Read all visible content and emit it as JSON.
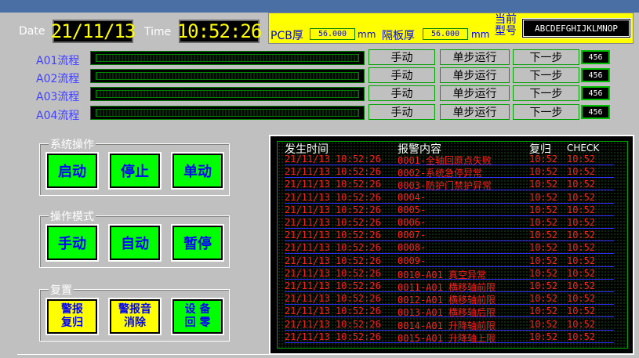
{
  "header": {
    "date_label": "Date",
    "date_value": "21/11/13",
    "time_label": "Time",
    "time_value": "10:52:26"
  },
  "pcb_panel": {
    "pcb_label": "PCB厚",
    "pcb_value": "56.000",
    "pcb_unit": "mm",
    "spacer_label": "隔板厚",
    "spacer_value": "56.000",
    "spacer_unit": "mm",
    "type_label_top": "当前",
    "type_label_bottom": "型号",
    "type_value": "ABCDEFGHIJKLMNOP"
  },
  "processes": [
    {
      "label": "A01流程",
      "manual": "手动",
      "step_run": "单步运行",
      "next": "下一步",
      "count": "456"
    },
    {
      "label": "A02流程",
      "manual": "手动",
      "step_run": "单步运行",
      "next": "下一步",
      "count": "456"
    },
    {
      "label": "A03流程",
      "manual": "手动",
      "step_run": "单步运行",
      "next": "下一步",
      "count": "456"
    },
    {
      "label": "A04流程",
      "manual": "手动",
      "step_run": "单步运行",
      "next": "下一步",
      "count": "456"
    }
  ],
  "system_ops": {
    "title": "系统操作",
    "start": "启动",
    "stop": "停止",
    "single": "单动"
  },
  "mode": {
    "title": "操作模式",
    "manual": "手动",
    "auto": "自动",
    "pause": "暂停"
  },
  "reset": {
    "title": "复置",
    "alarm_reset_1": "警报",
    "alarm_reset_2": "复归",
    "alarm_mute_1": "警报音",
    "alarm_mute_2": "消除",
    "device_home_1": "设 备",
    "device_home_2": "回 零"
  },
  "alarm_table": {
    "headers": {
      "time": "发生时间",
      "content": "报警内容",
      "reset": "复归",
      "check": "CHECK"
    },
    "rows": [
      {
        "time": "21/11/13 10:52:26",
        "content": "0001-全轴回原点失败",
        "reset": "10:52",
        "check": "10:52"
      },
      {
        "time": "21/11/13 10:52:26",
        "content": "0002-系统急停异常",
        "reset": "10:52",
        "check": "10:52"
      },
      {
        "time": "21/11/13 10:52:26",
        "content": "0003-防护门禁护异常",
        "reset": "10:52",
        "check": "10:52"
      },
      {
        "time": "21/11/13 10:52:26",
        "content": "0004-",
        "reset": "10:52",
        "check": "10:52"
      },
      {
        "time": "21/11/13 10:52:26",
        "content": "0005-",
        "reset": "10:52",
        "check": "10:52"
      },
      {
        "time": "21/11/13 10:52:26",
        "content": "0006-",
        "reset": "10:52",
        "check": "10:52"
      },
      {
        "time": "21/11/13 10:52:26",
        "content": "0007-",
        "reset": "10:52",
        "check": "10:52"
      },
      {
        "time": "21/11/13 10:52:26",
        "content": "0008-",
        "reset": "10:52",
        "check": "10:52"
      },
      {
        "time": "21/11/13 10:52:26",
        "content": "0009-",
        "reset": "10:52",
        "check": "10:52"
      },
      {
        "time": "21/11/13 10:52:26",
        "content": "0010-A01 真空异常",
        "reset": "10:52",
        "check": "10:52"
      },
      {
        "time": "21/11/13 10:52:26",
        "content": "0011-A01 横移轴前限",
        "reset": "10:52",
        "check": "10:52"
      },
      {
        "time": "21/11/13 10:52:26",
        "content": "0012-A01 横移轴前限",
        "reset": "10:52",
        "check": "10:52"
      },
      {
        "time": "21/11/13 10:52:26",
        "content": "0013-A01 横移轴后限",
        "reset": "10:52",
        "check": "10:52"
      },
      {
        "time": "21/11/13 10:52:26",
        "content": "0014-A01 升降轴前限",
        "reset": "10:52",
        "check": "10:52"
      },
      {
        "time": "21/11/13 10:52:26",
        "content": "0015-A01 升降轴上限",
        "reset": "10:52",
        "check": "10:52"
      }
    ]
  },
  "colors": {
    "background": "#c0c0c0",
    "button_green": "#00ff00",
    "button_yellow": "#ffff00",
    "alarm_text": "#ff2020",
    "label_blue": "#4040ff"
  }
}
